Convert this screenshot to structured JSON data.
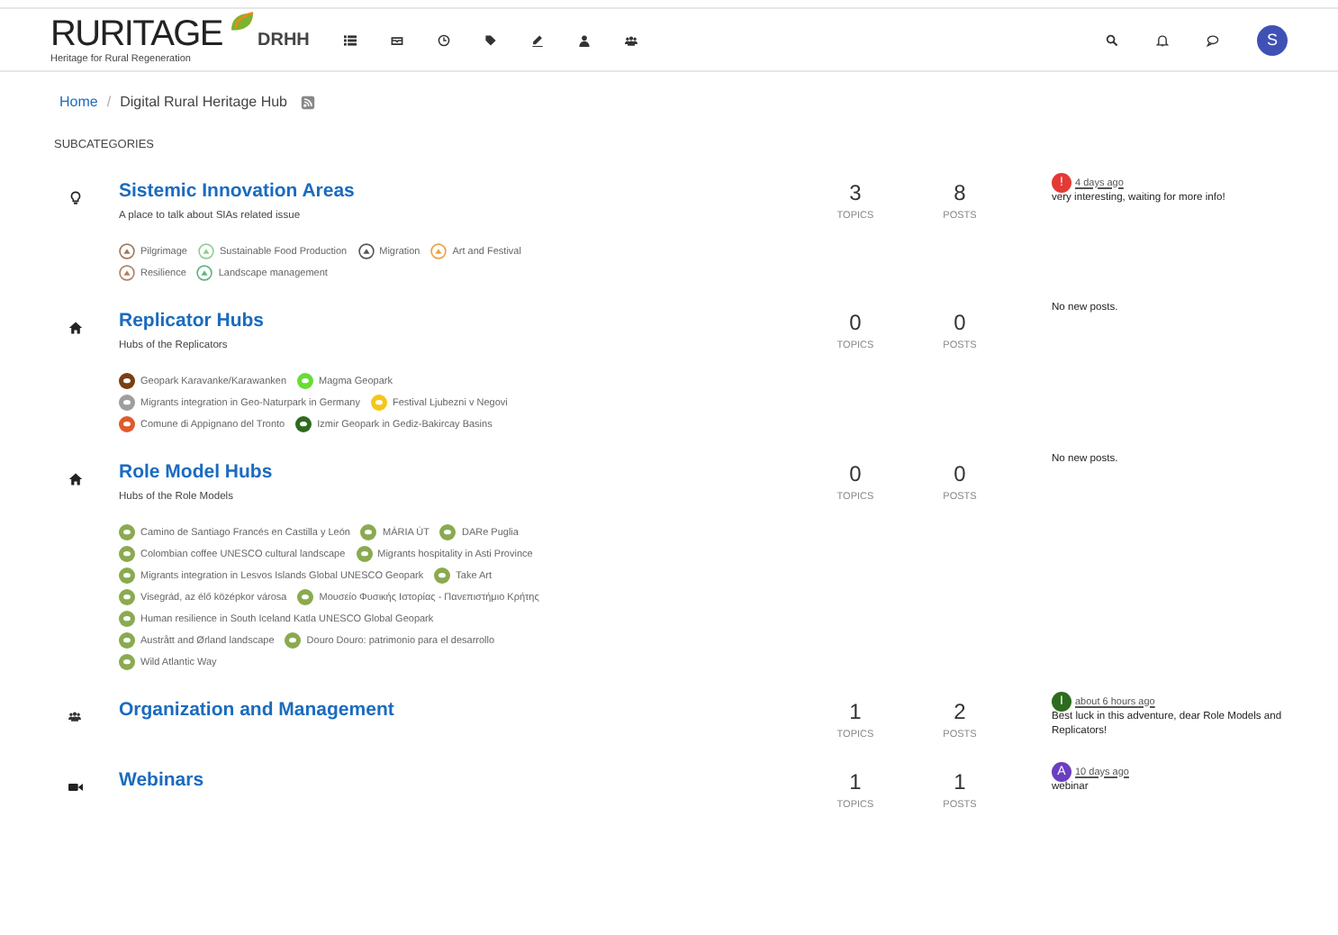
{
  "header": {
    "logo": "RURITAGE",
    "tagline": "Heritage for Rural Regeneration",
    "site": "DRHH",
    "nav": [
      {
        "kind": "list"
      },
      {
        "kind": "inbox"
      },
      {
        "kind": "clock"
      },
      {
        "kind": "tags"
      },
      {
        "kind": "pencil"
      },
      {
        "kind": "user"
      },
      {
        "kind": "users"
      }
    ],
    "tools": [
      {
        "kind": "search"
      },
      {
        "kind": "bell"
      },
      {
        "kind": "chat"
      }
    ],
    "avatar": {
      "letter": "S",
      "color": "#3f51b5"
    }
  },
  "breadcrumb": {
    "home": "Home",
    "separator": "/",
    "current": "Digital Rural Heritage Hub"
  },
  "section_title": "SUBCATEGORIES",
  "categories": [
    {
      "kind": "bulb",
      "title": "Sistemic Innovation Areas",
      "description": "A place to talk about SIAs related issue",
      "topics": "3",
      "topics_label": "TOPICS",
      "posts": "8",
      "posts_label": "POSTS",
      "last_post": {
        "kind": "post",
        "avatar": "!",
        "color": "#e53935",
        "time": "4 days ago",
        "text": "very interesting, waiting for more info!"
      },
      "subcategories": [
        {
          "kind": "image",
          "name": "Pilgrimage",
          "color": "#a0785a"
        },
        {
          "kind": "image",
          "name": "Sustainable Food Production",
          "color": "#8fcf8f"
        },
        {
          "kind": "image",
          "name": "Migration",
          "color": "#555555"
        },
        {
          "kind": "image",
          "name": "Art and Festival",
          "color": "#f0a040"
        },
        {
          "kind": "image",
          "name": "Resilience",
          "color": "#b08060"
        },
        {
          "kind": "image",
          "name": "Landscape management",
          "color": "#5fb37f"
        }
      ]
    },
    {
      "kind": "home",
      "title": "Replicator Hubs",
      "description": "Hubs of the Replicators",
      "topics": "0",
      "topics_label": "TOPICS",
      "posts": "0",
      "posts_label": "POSTS",
      "last_post": {
        "kind": "none",
        "text": "No new posts."
      },
      "subcategories": [
        {
          "kind": "badge",
          "name": "Geopark Karavanke/Karawanken",
          "color": "#7a3e10"
        },
        {
          "kind": "badge",
          "name": "Magma Geopark",
          "color": "#66dd33"
        },
        {
          "kind": "badge",
          "name": "Migrants integration in Geo-Naturpark in Germany",
          "color": "#9e9e9e"
        },
        {
          "kind": "badge",
          "name": "Festival Ljubezni v Negovi",
          "color": "#f5c518"
        },
        {
          "kind": "badge",
          "name": "Comune di Appignano del Tronto",
          "color": "#e05a2b"
        },
        {
          "kind": "badge",
          "name": "Izmir Geopark in Gediz-Bakircay Basins",
          "color": "#2e6b1e"
        }
      ]
    },
    {
      "kind": "home",
      "title": "Role Model Hubs",
      "description": "Hubs of the Role Models",
      "topics": "0",
      "topics_label": "TOPICS",
      "posts": "0",
      "posts_label": "POSTS",
      "last_post": {
        "kind": "none",
        "text": "No new posts."
      },
      "subcategories": [
        {
          "kind": "badge",
          "name": "Camino de Santiago Francés en Castilla y León",
          "color": "#8aaa50"
        },
        {
          "kind": "badge",
          "name": "MÁRIA ÚT",
          "color": "#8aaa50"
        },
        {
          "kind": "badge",
          "name": "DARe Puglia",
          "color": "#8aaa50"
        },
        {
          "kind": "badge",
          "name": "Colombian coffee UNESCO cultural landscape",
          "color": "#8aaa50"
        },
        {
          "kind": "badge",
          "name": "Migrants hospitality in Asti Province",
          "color": "#8aaa50"
        },
        {
          "kind": "badge",
          "name": "Migrants integration in Lesvos Islands Global UNESCO Geopark",
          "color": "#8aaa50"
        },
        {
          "kind": "badge",
          "name": "Take Art",
          "color": "#8aaa50"
        },
        {
          "kind": "badge",
          "name": "Visegrád, az élő középkor városa",
          "color": "#8aaa50"
        },
        {
          "kind": "badge",
          "name": "Μουσείο Φυσικής Ιστορίας - Πανεπιστήμιο Κρήτης",
          "color": "#8aaa50"
        },
        {
          "kind": "badge",
          "name": "Human resilience in South Iceland Katla UNESCO Global Geopark",
          "color": "#8aaa50"
        },
        {
          "kind": "badge",
          "name": "Austrått and Ørland landscape",
          "color": "#8aaa50"
        },
        {
          "kind": "badge",
          "name": "Douro Douro: patrimonio para el desarrollo",
          "color": "#8aaa50"
        },
        {
          "kind": "badge",
          "name": "Wild Atlantic Way",
          "color": "#8aaa50"
        }
      ]
    },
    {
      "kind": "users",
      "title": "Organization and Management",
      "topics": "1",
      "topics_label": "TOPICS",
      "posts": "2",
      "posts_label": "POSTS",
      "last_post": {
        "kind": "post",
        "avatar": "I",
        "color": "#2e6b1e",
        "time": "about 6 hours ago",
        "text": "Best luck in this adventure, dear Role Models and Replicators!"
      }
    },
    {
      "kind": "video",
      "title": "Webinars",
      "topics": "1",
      "topics_label": "TOPICS",
      "posts": "1",
      "posts_label": "POSTS",
      "last_post": {
        "kind": "post",
        "avatar": "A",
        "color": "#6a3fc0",
        "time": "10 days ago",
        "text": "webinar"
      }
    }
  ]
}
